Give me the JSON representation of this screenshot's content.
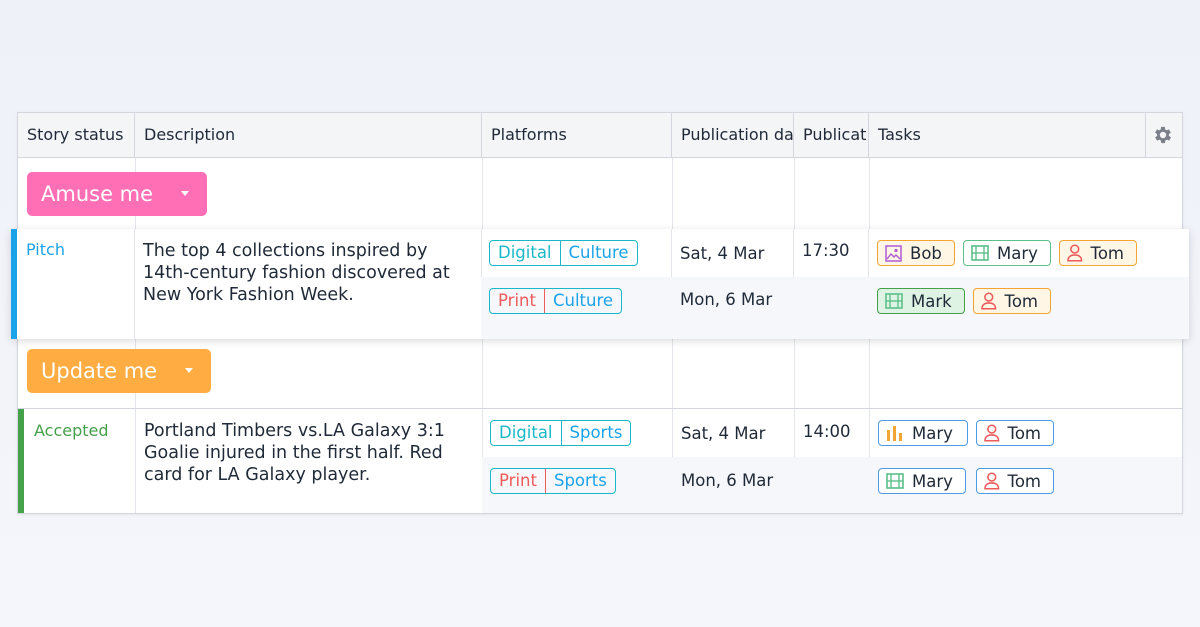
{
  "columns": {
    "story_status": "Story status",
    "description": "Description",
    "platforms": "Platforms",
    "pub_date": "Publication da",
    "pub_time": "Publicat",
    "tasks": "Tasks"
  },
  "groups": [
    {
      "label": "Amuse me",
      "color": "#ff6fb5"
    },
    {
      "label": "Update me",
      "color": "#ffad42"
    }
  ],
  "stories": [
    {
      "status": "Pitch",
      "status_color": "#1aa3e8",
      "description": "The top 4 collections inspired by 14th-century fashion discovered at New York Fashion Week.",
      "rows": [
        {
          "platform": "Digital",
          "category": "Culture",
          "date": "Sat, 4 Mar",
          "time": "17:30",
          "tasks": [
            "Bob",
            "Mary",
            "Tom"
          ]
        },
        {
          "platform": "Print",
          "category": "Culture",
          "date": "Mon, 6 Mar",
          "time": "",
          "tasks": [
            "Mark",
            "Tom"
          ]
        }
      ]
    },
    {
      "status": "Accepted",
      "status_color": "#45a04a",
      "description": "Portland Timbers vs.LA Galaxy 3:1 Goalie injured in the first half. Red card for LA Galaxy player.",
      "rows": [
        {
          "platform": "Digital",
          "category": "Sports",
          "date": "Sat, 4 Mar",
          "time": "14:00",
          "tasks": [
            "Mary",
            "Tom"
          ]
        },
        {
          "platform": "Print",
          "category": "Sports",
          "date": "Mon, 6 Mar",
          "time": "",
          "tasks": [
            "Mary",
            "Tom"
          ]
        }
      ]
    }
  ],
  "icons": {
    "settings": "gear-icon",
    "image": "image-icon",
    "video": "film-icon",
    "person": "person-icon",
    "chart": "bar-chart-icon",
    "dropdown": "caret-down-icon"
  },
  "colors": {
    "digital": "#19b8c8",
    "print": "#ef5a5a",
    "category": "#1aa3e8",
    "image_task": "#f2a532",
    "video_task": "#5cc08a",
    "person_task": "#f2a532",
    "chart_task": "#4c9be6"
  }
}
